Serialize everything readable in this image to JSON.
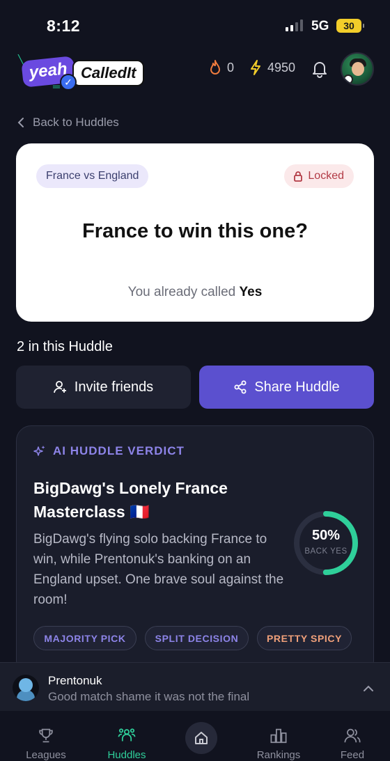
{
  "status_bar": {
    "time": "8:12",
    "network": "5G",
    "battery": "30"
  },
  "header": {
    "logo_part1": "yeah",
    "logo_part2": "CalledIt",
    "streak_count": "0",
    "points": "4950"
  },
  "back_link": "Back to Huddles",
  "question_card": {
    "match": "France vs England",
    "status": "Locked",
    "question": "France to win this one?",
    "called_prefix": "You already called",
    "called_value": "Yes"
  },
  "huddle": {
    "count_text": "2 in this Huddle",
    "invite_label": "Invite friends",
    "share_label": "Share Huddle"
  },
  "verdict": {
    "label": "AI HUDDLE VERDICT",
    "title": "BigDawg's Lonely France Masterclass 🇫🇷",
    "body": "BigDawg's flying solo backing France to win, while Prentonuk's banking on an England upset. One brave soul against the room!",
    "percent_text": "50%",
    "percent_value": 0.5,
    "percent_caption": "BACK YES",
    "tags": [
      "MAJORITY PICK",
      "SPLIT DECISION",
      "PRETTY SPICY"
    ]
  },
  "comment": {
    "author": "Prentonuk",
    "text": "Good match shame it was not the final"
  },
  "nav": {
    "items": [
      "Leagues",
      "Huddles",
      "Rankings",
      "Feed"
    ],
    "active": "Huddles"
  },
  "colors": {
    "accent": "#5b50cf",
    "verdict_accent": "#8d84e8",
    "gauge": "#2fcf9a",
    "locked": "#b23a45",
    "spicy": "#f0a07a"
  }
}
